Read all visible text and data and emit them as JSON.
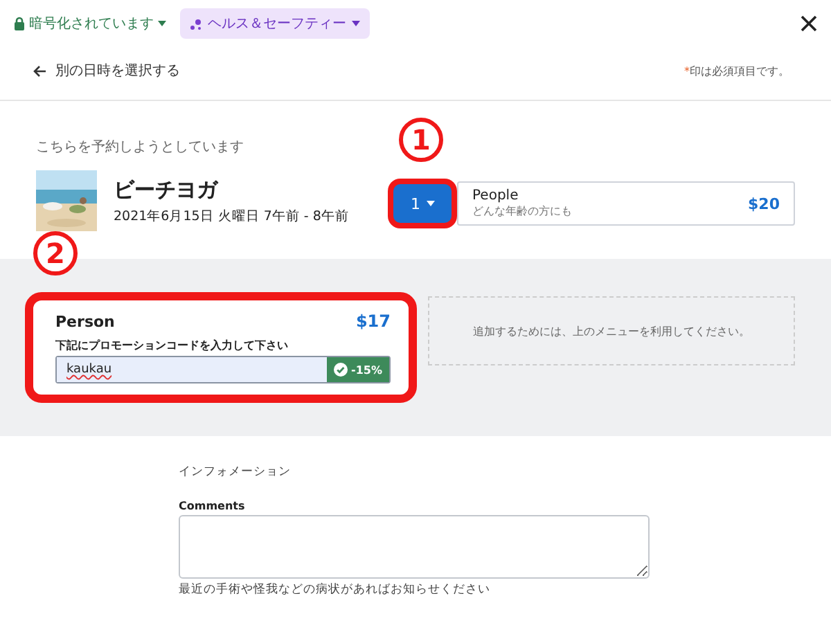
{
  "top_bar": {
    "encryption": "暗号化されています",
    "health": "ヘルス＆セーフティー"
  },
  "back_link": "別の日時を選択する",
  "required_note": {
    "mark": "*",
    "text": "印は必須項目です。"
  },
  "booking": {
    "heading": "こちらを予約しようとしています",
    "title": "ビーチヨガ",
    "date": "2021年6月15日 火曜日 7午前 - 8午前"
  },
  "ticket": {
    "quantity": "1",
    "name": "People",
    "description": "どんな年齢の方にも",
    "price": "$20"
  },
  "person_card": {
    "name": "Person",
    "price": "$17",
    "promo_label": "下記にプロモーションコードを入力して下さい",
    "promo_value": "kaukau",
    "discount": "-15%"
  },
  "empty_slot": "追加するためには、上のメニューを利用してください。",
  "info": {
    "heading": "インフォメーション",
    "comments_label": "Comments",
    "hint": "最近の手術や怪我などの病状があればお知らせください"
  },
  "annotations": [
    {
      "label": "1"
    },
    {
      "label": "2"
    }
  ]
}
